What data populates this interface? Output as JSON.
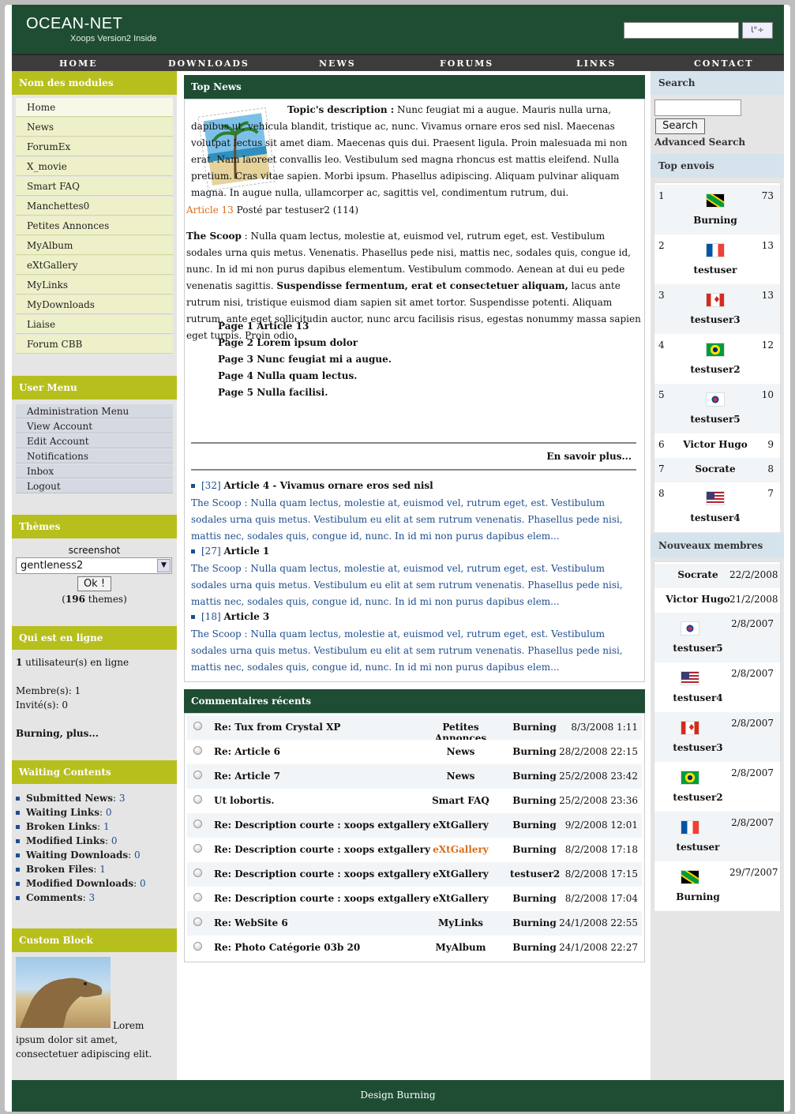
{
  "header": {
    "logo": "OCEAN-NET",
    "tagline": "Xoops Version2 Inside",
    "search_btn": "ﺎ°÷"
  },
  "nav": [
    "HOME",
    "DOWNLOADS",
    "NEWS",
    "FORUMS",
    "LINKS",
    "CONTACT"
  ],
  "modules": {
    "title": "Nom des modules",
    "items": [
      "Home",
      "News",
      "ForumEx",
      "X_movie",
      "Smart FAQ",
      "Manchettes0",
      "Petites Annonces",
      "MyAlbum",
      "eXtGallery",
      "MyLinks",
      "MyDownloads",
      "Liaise",
      "Forum CBB"
    ]
  },
  "user_menu": {
    "title": "User Menu",
    "items": [
      "Administration Menu",
      "View Account",
      "Edit Account",
      "Notifications",
      "Inbox",
      "Logout"
    ]
  },
  "themes": {
    "title": "Thèmes",
    "screenshot": "screenshot",
    "selected": "gentleness2",
    "ok": "Ok !",
    "count": "196",
    "count_suffix": " themes)",
    "count_prefix": "("
  },
  "online": {
    "title": "Qui est en ligne",
    "users_count": "1",
    "users_text": " utilisateur(s) en ligne",
    "members": "Membre(s): 1",
    "guests": "Invité(s): 0",
    "names": "Burning, plus..."
  },
  "waiting": {
    "title": "Waiting Contents",
    "items": [
      {
        "label": "Submitted News",
        "n": "3"
      },
      {
        "label": "Waiting Links",
        "n": "0"
      },
      {
        "label": "Broken Links",
        "n": "1"
      },
      {
        "label": "Modified Links",
        "n": "0"
      },
      {
        "label": "Waiting Downloads",
        "n": "0"
      },
      {
        "label": "Broken Files",
        "n": "1"
      },
      {
        "label": "Modified Downloads",
        "n": "0"
      },
      {
        "label": "Comments",
        "n": "3"
      }
    ]
  },
  "custom": {
    "title": "Custom Block",
    "text": "Lorem ipsum dolor sit amet, consectetuer adipiscing elit."
  },
  "top_news": {
    "title": "Top News",
    "topic_label": "Topic's description :",
    "topic_text": " Nunc feugiat mi a augue. Mauris nulla urna, dapibus ut, vehicula blandit, tristique ac, nunc. Vivamus ornare eros sed nisl. Maecenas volutpat lectus sit amet diam. Maecenas quis dui. Praesent ligula. Proin malesuada mi non erat. Nam laoreet convallis leo. Vestibulum sed magna rhoncus est mattis eleifend. Nulla pretium. Cras vitae sapien. Morbi ipsum. Phasellus adipiscing. Aliquam pulvinar aliquam magna. In augue nulla, ullamcorper ac, sagittis vel, condimentum rutrum, dui.",
    "article_link": "Article 13",
    "article_meta": " Posté par testuser2 (114)",
    "scoop_label": "The Scoop",
    "scoop_text1": " : Nulla quam lectus, molestie at, euismod vel, rutrum eget, est. Vestibulum sodales urna quis metus. Venenatis. Phasellus pede nisi, mattis nec, sodales quis, congue id, nunc. In id mi non purus dapibus elementum. Vestibulum commodo. Aenean at dui eu pede venenatis sagittis. ",
    "scoop_bold": "Suspendisse fermentum, erat et consectetuer aliquam,",
    "scoop_text2": " lacus ante rutrum nisi, tristique euismod diam sapien sit amet tortor. Suspendisse potenti. Aliquam rutrum, ante eget sollicitudin auctor, nunc arcu facilisis risus, egestas nonummy massa sapien eget turpis. Proin odio.",
    "pages": [
      "Page 1 Article 13",
      "Page 2 Lorem ipsum dolor",
      "Page 3 Nunc feugiat mi a augue.",
      "Page 4 Nulla quam lectus.",
      "Page 5 Nulla facilisi."
    ],
    "read_more": "En savoir plus...",
    "others": [
      {
        "id": "[32]",
        "title": "Article 4 - Vivamus ornare eros sed nisl"
      },
      {
        "id": "[27]",
        "title": "Article 1"
      },
      {
        "id": "[18]",
        "title": "Article 3"
      }
    ],
    "other_text": "The Scoop : Nulla quam lectus, molestie at, euismod vel, rutrum eget, est. Vestibulum sodales urna quis metus. Vestibulum eu elit at sem rutrum venenatis. Phasellus pede nisi, mattis nec, sodales quis, congue id, nunc. In id mi non purus dapibus elem..."
  },
  "comments": {
    "title": "Commentaires récents",
    "rows": [
      {
        "t": "Re: Tux from Crystal XP",
        "m": "Petites Annonces",
        "u": "Burning",
        "d": "8/3/2008 1:11"
      },
      {
        "t": "Re: Article 6",
        "m": "News",
        "u": "Burning",
        "d": "28/2/2008 22:15"
      },
      {
        "t": "Re: Article 7",
        "m": "News",
        "u": "Burning",
        "d": "25/2/2008 23:42"
      },
      {
        "t": "Ut lobortis.",
        "m": "Smart FAQ",
        "u": "Burning",
        "d": "25/2/2008 23:36"
      },
      {
        "t": "Re: Description courte : xoops extgallery",
        "m": "eXtGallery",
        "u": "Burning",
        "d": "9/2/2008 12:01"
      },
      {
        "t": "Re: Description courte : xoops extgallery",
        "m": "eXtGallery",
        "u": "Burning",
        "d": "8/2/2008 17:18"
      },
      {
        "t": "Re: Description courte : xoops extgallery",
        "m": "eXtGallery",
        "u": "testuser2",
        "d": "8/2/2008 17:15"
      },
      {
        "t": "Re: Description courte : xoops extgallery",
        "m": "eXtGallery",
        "u": "Burning",
        "d": "8/2/2008 17:04"
      },
      {
        "t": "Re: WebSite 6",
        "m": "MyLinks",
        "u": "Burning",
        "d": "24/1/2008 22:55"
      },
      {
        "t": "Re: Photo Catégorie 03b 20",
        "m": "MyAlbum",
        "u": "Burning",
        "d": "24/1/2008 22:27"
      }
    ]
  },
  "search": {
    "title": "Search",
    "button": "Search",
    "advanced": "Advanced Search"
  },
  "top_posters": {
    "title": "Top envois",
    "rows": [
      {
        "r": "1",
        "name": "Burning",
        "n": "73",
        "flag": "jamaica"
      },
      {
        "r": "2",
        "name": "testuser",
        "n": "13",
        "flag": "france"
      },
      {
        "r": "3",
        "name": "testuser3",
        "n": "13",
        "flag": "canada"
      },
      {
        "r": "4",
        "name": "testuser2",
        "n": "12",
        "flag": "brazil"
      },
      {
        "r": "5",
        "name": "testuser5",
        "n": "10",
        "flag": "korea"
      },
      {
        "r": "6",
        "name": "Victor Hugo",
        "n": "9",
        "flag": ""
      },
      {
        "r": "7",
        "name": "Socrate",
        "n": "8",
        "flag": ""
      },
      {
        "r": "8",
        "name": "testuser4",
        "n": "7",
        "flag": "usa"
      }
    ]
  },
  "new_members": {
    "title": "Nouveaux membres",
    "rows": [
      {
        "name": "Socrate",
        "d": "22/2/2008",
        "flag": ""
      },
      {
        "name": "Victor Hugo",
        "d": "21/2/2008",
        "flag": ""
      },
      {
        "name": "testuser5",
        "d": "2/8/2007",
        "flag": "korea"
      },
      {
        "name": "testuser4",
        "d": "2/8/2007",
        "flag": "usa"
      },
      {
        "name": "testuser3",
        "d": "2/8/2007",
        "flag": "canada"
      },
      {
        "name": "testuser2",
        "d": "2/8/2007",
        "flag": "brazil"
      },
      {
        "name": "testuser",
        "d": "2/8/2007",
        "flag": "france"
      },
      {
        "name": "Burning",
        "d": "29/7/2007",
        "flag": "jamaica"
      }
    ]
  },
  "footer": "Design Burning"
}
